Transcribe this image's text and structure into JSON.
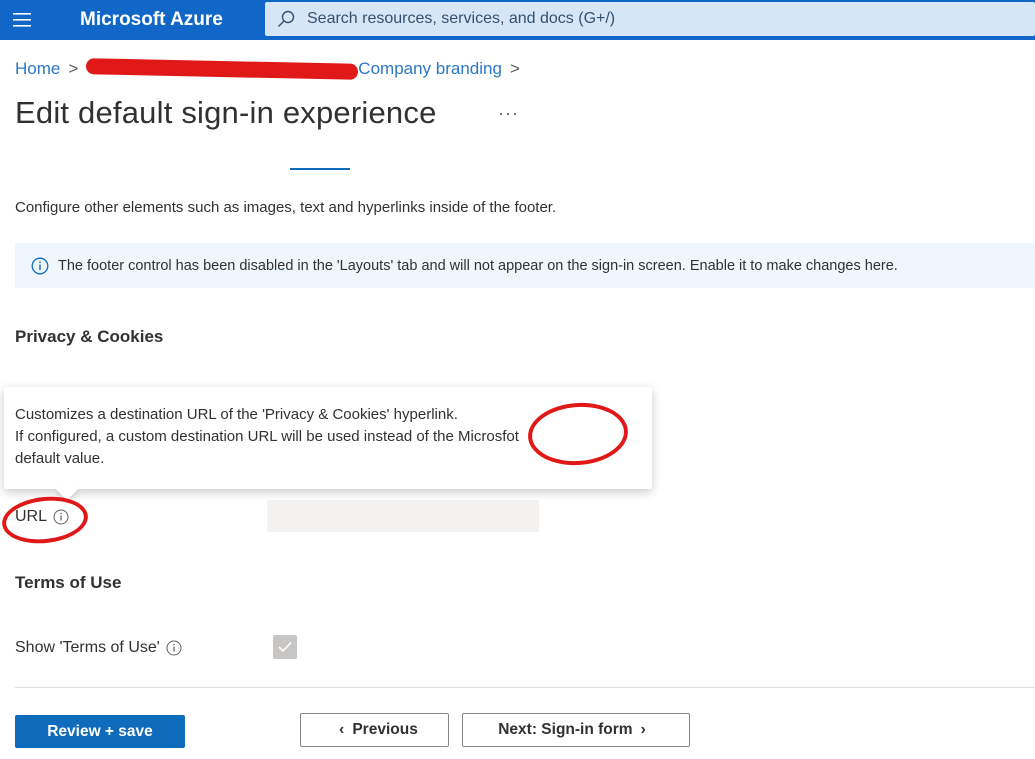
{
  "topbar": {
    "brand": "Microsoft Azure",
    "search_placeholder": "Search resources, services, and docs (G+/)"
  },
  "breadcrumb": {
    "home": "Home",
    "separator": ">",
    "current": "Company branding"
  },
  "page": {
    "title": "Edit default sign-in experience",
    "more": "···",
    "description": "Configure other elements such as images, text and hyperlinks inside of the footer.",
    "info_message": "The footer control has been disabled in the 'Layouts' tab and will not appear on the sign-in screen. Enable it to make changes here."
  },
  "privacy": {
    "section_title": "Privacy & Cookies",
    "tooltip_line1": "Customizes a destination URL of the 'Privacy & Cookies' hyperlink.",
    "tooltip_line2": "If configured, a custom destination URL will be used instead of the Microsfot",
    "tooltip_line3": "default value.",
    "url_label": "URL",
    "url_value": ""
  },
  "terms": {
    "section_title": "Terms of Use",
    "show_label": "Show 'Terms of Use'",
    "show_checked": true
  },
  "footer_buttons": {
    "review_save": "Review + save",
    "previous": "Previous",
    "next": "Next: Sign-in form"
  },
  "colors": {
    "accent": "#0f6cbd",
    "annotation": "#e01818"
  },
  "icons": {
    "menu": "hamburger-icon",
    "search": "search-icon",
    "info": "info-icon",
    "check": "checkmark-icon"
  }
}
